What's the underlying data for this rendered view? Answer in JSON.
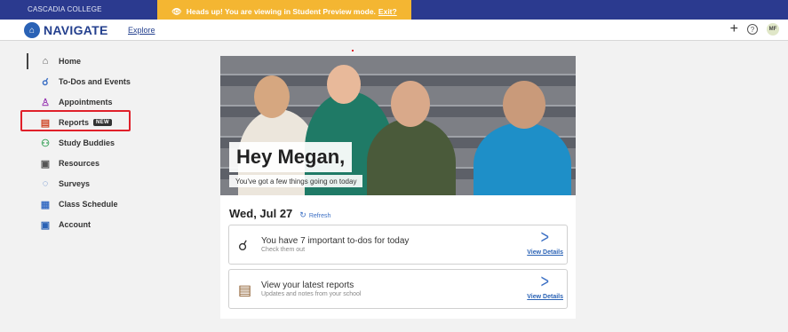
{
  "topbar": {
    "college": "CASCADIA COLLEGE",
    "banner_text": "Heads up! You are viewing in Student Preview mode.",
    "banner_link": "Exit?"
  },
  "nav": {
    "brand": "NAVIGATE",
    "explore": "Explore",
    "avatar_initials": "MF",
    "help": "?",
    "plus": "+"
  },
  "sidebar": {
    "items": [
      {
        "label": "Home",
        "icon": "home-icon"
      },
      {
        "label": "To-Dos and Events",
        "icon": "todo-icon"
      },
      {
        "label": "Appointments",
        "icon": "person-icon"
      },
      {
        "label": "Reports",
        "icon": "report-icon",
        "badge": "NEW"
      },
      {
        "label": "Study Buddies",
        "icon": "buddies-icon"
      },
      {
        "label": "Resources",
        "icon": "resources-icon"
      },
      {
        "label": "Surveys",
        "icon": "survey-icon"
      },
      {
        "label": "Class Schedule",
        "icon": "schedule-icon"
      },
      {
        "label": "Account",
        "icon": "account-icon"
      }
    ]
  },
  "hero": {
    "greeting": "Hey Megan,",
    "subtitle": "You've got a few things going on today"
  },
  "today": {
    "date": "Wed, Jul 27",
    "refresh": "Refresh"
  },
  "cards": [
    {
      "title": "You have 7 important to-dos for today",
      "subtitle": "Check them out",
      "link": "View Details",
      "icon": "todo-icon"
    },
    {
      "title": "View your latest reports",
      "subtitle": "Updates and notes from your school",
      "link": "View Details",
      "icon": "report-icon"
    }
  ],
  "colors": {
    "topbar": "#2b3a8f",
    "banner": "#f4b632",
    "accent": "#2a62b5",
    "highlight": "#e0202a"
  }
}
